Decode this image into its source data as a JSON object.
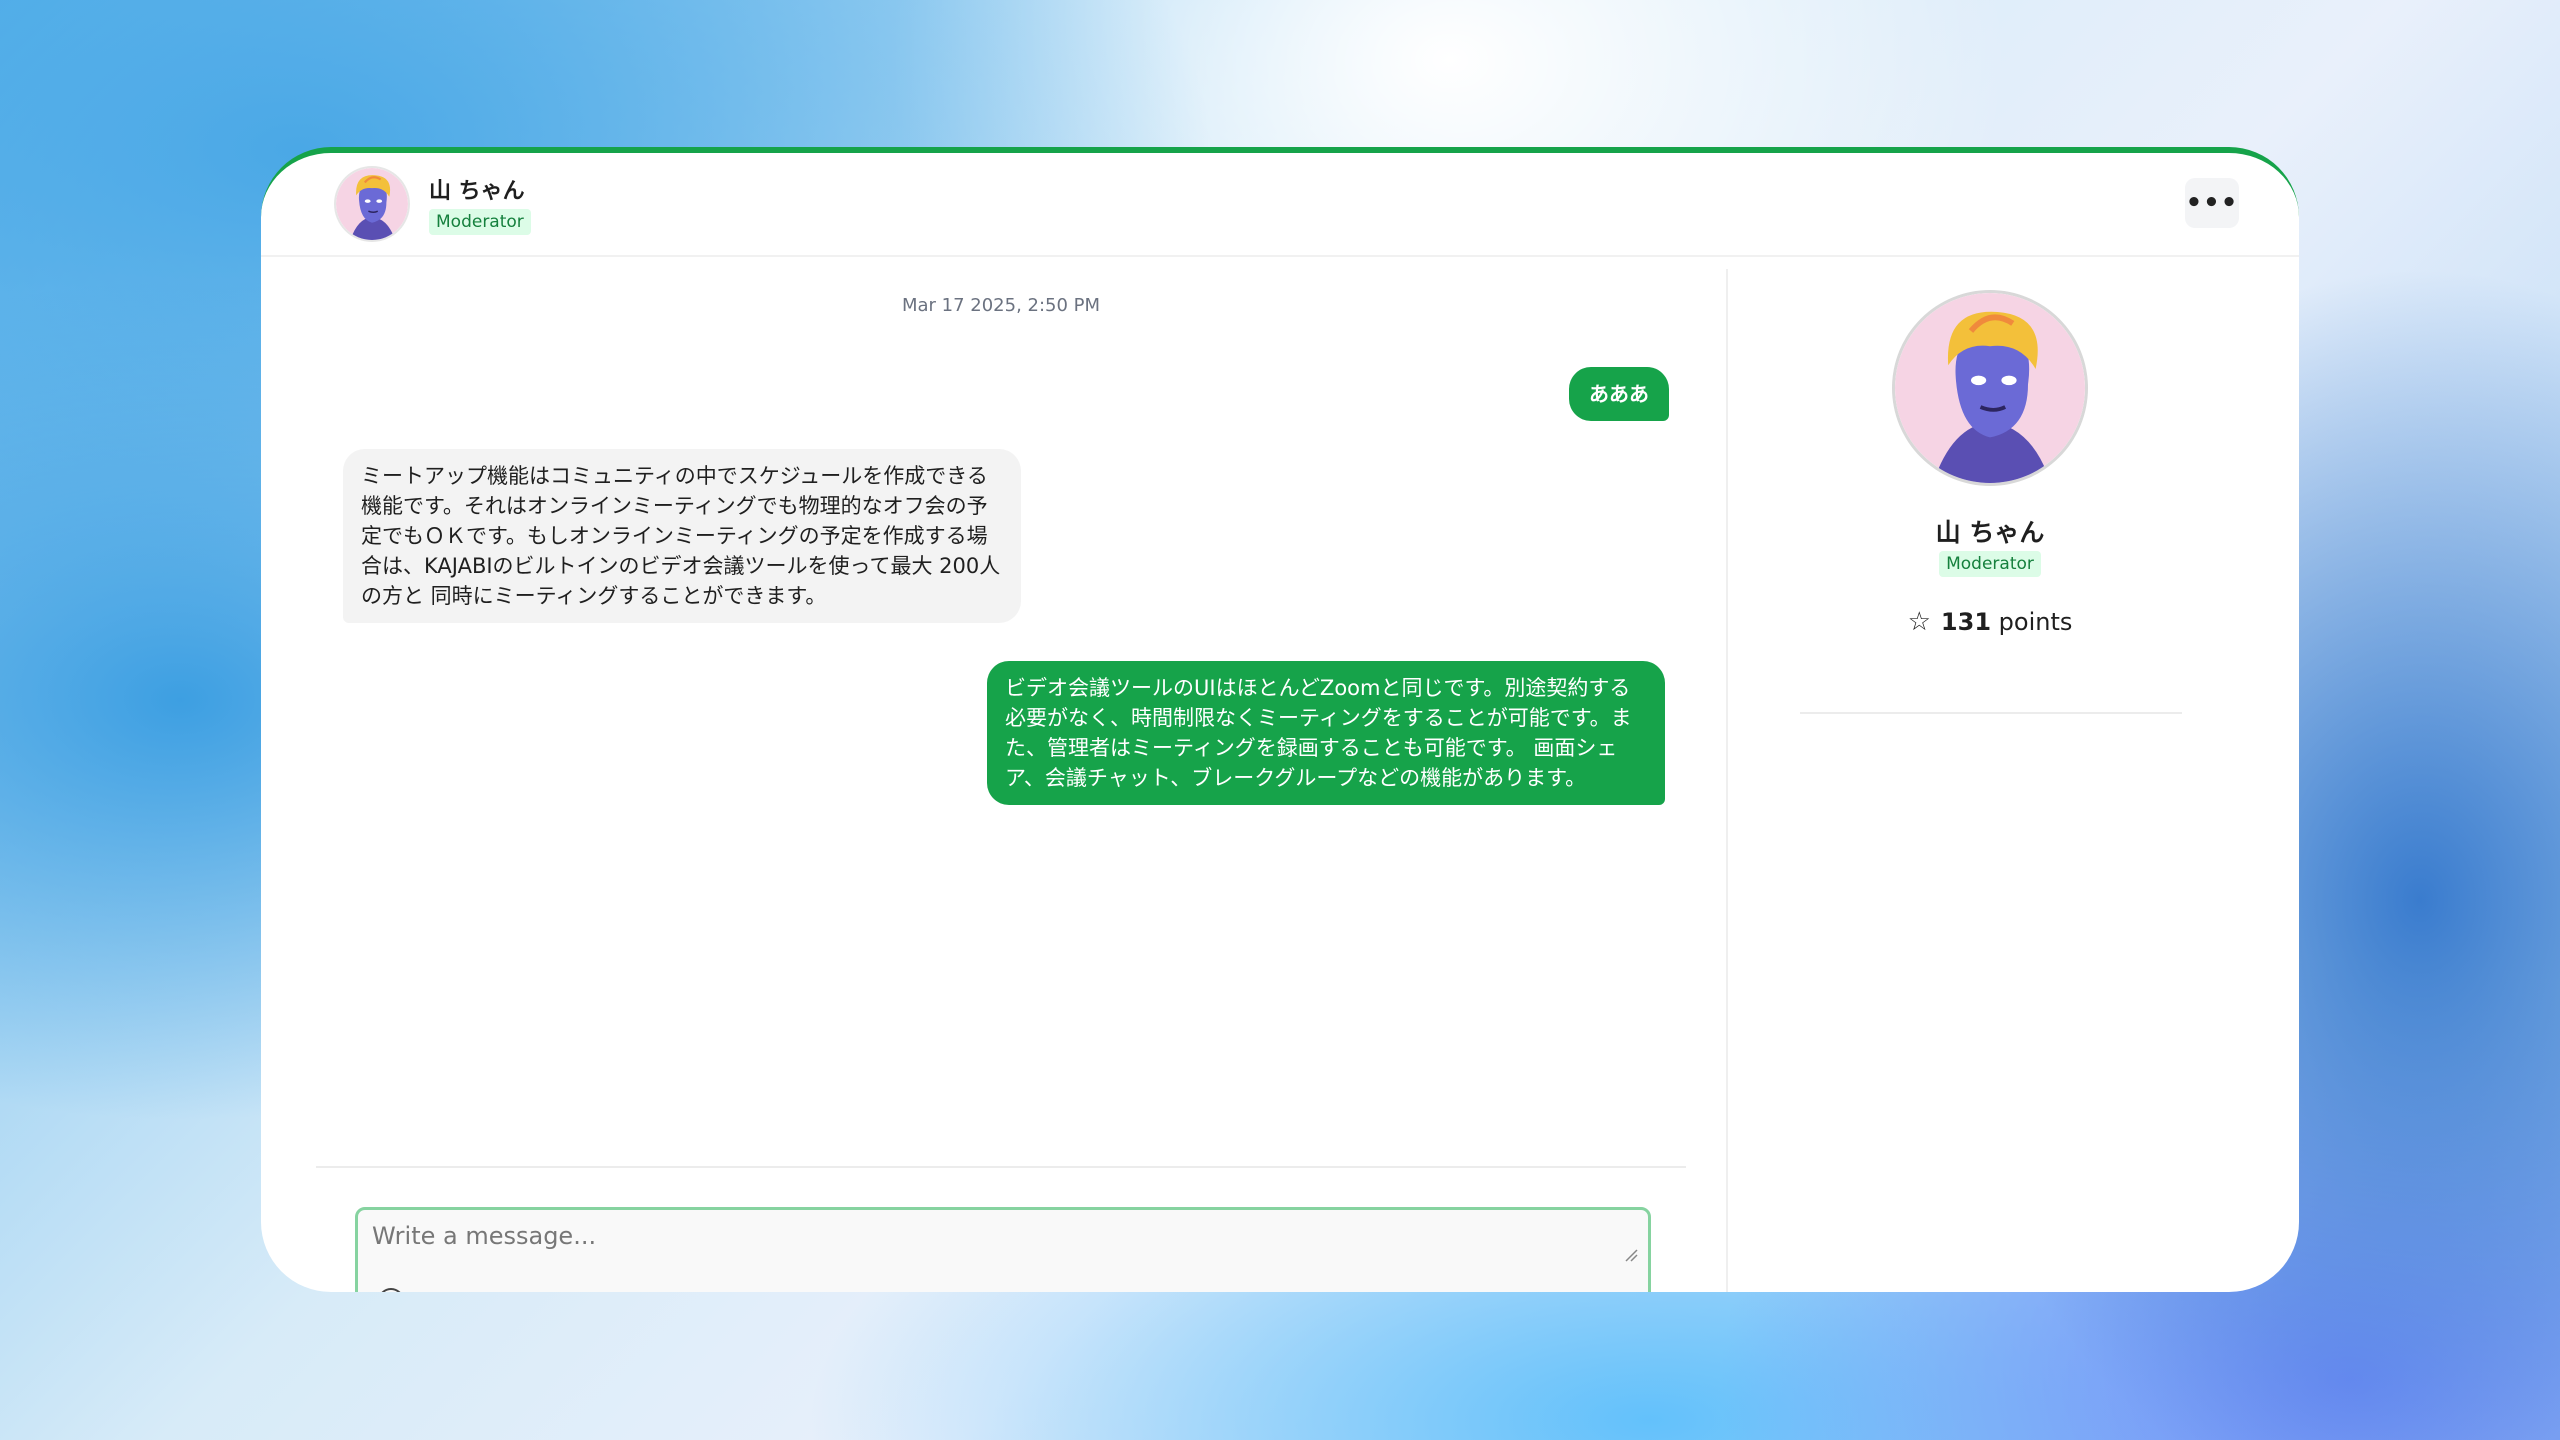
{
  "header": {
    "user_name": "山 ちゃん",
    "role_badge": "Moderator",
    "more_label": "•••"
  },
  "chat": {
    "timestamp": "Mar 17 2025, 2:50 PM",
    "messages": [
      {
        "direction": "outgoing",
        "text": "あああ"
      },
      {
        "direction": "incoming",
        "text": "ミートアップ機能はコミュニティの中でスケジュールを作成できる機能です。それはオンラインミーティングでも物理的なオフ会の予定でもＯＫです。もしオンラインミーティングの予定を作成する場合は、KAJABIのビルトインのビデオ会議ツールを使って最大 200人 の方と 同時にミーティングすることができます。"
      },
      {
        "direction": "outgoing",
        "text": "ビデオ会議ツールのUIはほとんどZoomと同じです。別途契約する必要がなく、時間制限なくミーティングをすることが可能です。また、管理者はミーティングを録画することも可能です。 画面シェア、会議チャット、ブレークグループなどの機能があります。"
      }
    ]
  },
  "composer": {
    "placeholder": "Write a message...",
    "extra_text": "… ⌄  ⁄⁄"
  },
  "profile": {
    "name": "山 ちゃん",
    "role_badge": "Moderator",
    "points_value": "131",
    "points_label": "points"
  },
  "colors": {
    "accent": "#16a34a",
    "badge_bg": "#dcfce7",
    "badge_text": "#15803d"
  },
  "icons": {
    "more": "more-horizontal-icon",
    "star": "star-outline-icon",
    "attach": "plus-circle-icon"
  }
}
